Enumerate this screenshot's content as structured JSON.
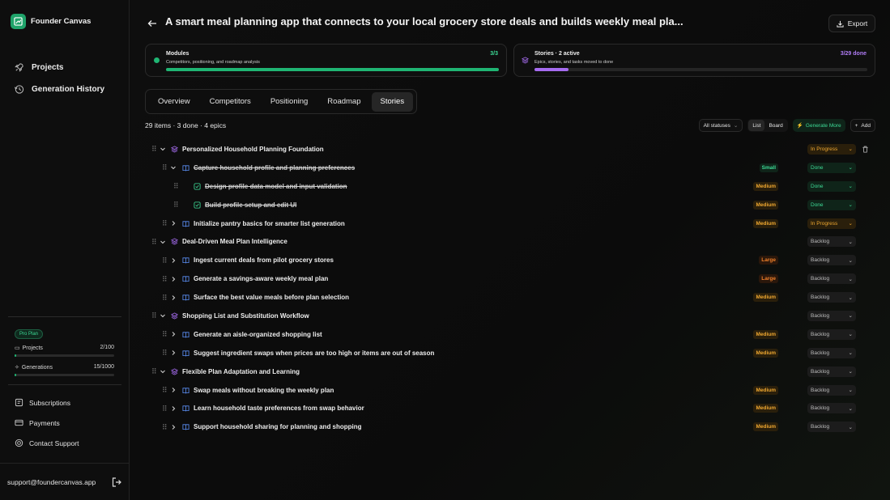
{
  "brand": {
    "name": "Founder Canvas",
    "accent": "#1fa36a"
  },
  "nav": [
    {
      "label": "Projects",
      "icon": "rocket-icon"
    },
    {
      "label": "Generation History",
      "icon": "history-icon"
    }
  ],
  "plan": {
    "badge": "Pro Plan",
    "projects": {
      "label": "Projects",
      "value": "2/100",
      "fraction": 0.02
    },
    "generations": {
      "label": "Generations",
      "value": "15/1000",
      "fraction": 0.015
    }
  },
  "side_links": [
    {
      "label": "Subscriptions",
      "icon": "subscriptions-icon"
    },
    {
      "label": "Payments",
      "icon": "credit-card-icon"
    },
    {
      "label": "Contact Support",
      "icon": "lifebuoy-icon"
    }
  ],
  "footer": {
    "email": "support@foundercanvas.app"
  },
  "header": {
    "title": "A smart meal planning app that connects to your local grocery store deals and builds weekly meal pla...",
    "export_label": "Export"
  },
  "modules_card": {
    "title": "Modules",
    "subtitle": "Competitors, positioning, and roadmap analysis",
    "value": "3/3",
    "progress": 1.0,
    "color": "#1fb573"
  },
  "stories_card": {
    "title": "Stories · 2 active",
    "subtitle": "Epics, stories, and tasks moved to done",
    "value": "3/29 done",
    "progress": 0.103,
    "color": "#a66cf0"
  },
  "tabs": [
    "Overview",
    "Competitors",
    "Positioning",
    "Roadmap",
    "Stories"
  ],
  "active_tab": "Stories",
  "summary": "29 items · 3 done · 4 epics",
  "filters": {
    "status_label": "All statuses",
    "view_list": "List",
    "view_board": "Board",
    "generate_label": "Generate More",
    "add_label": "Add"
  },
  "rows": [
    {
      "level": 0,
      "type": "epic",
      "text": "Personalized Household Planning Foundation",
      "size": "",
      "status": "In Progress",
      "expand": true,
      "done": false,
      "trash": true
    },
    {
      "level": 1,
      "type": "story",
      "text": "Capture household profile and planning preferences",
      "size": "Small",
      "status": "Done",
      "expand": true,
      "done": true
    },
    {
      "level": 2,
      "type": "task",
      "text": "Design profile data model and input validation",
      "size": "Medium",
      "status": "Done",
      "expand": false,
      "done": true
    },
    {
      "level": 2,
      "type": "task",
      "text": "Build profile setup and edit UI",
      "size": "Medium",
      "status": "Done",
      "expand": false,
      "done": true
    },
    {
      "level": 1,
      "type": "story",
      "text": "Initialize pantry basics for smarter list generation",
      "size": "Medium",
      "status": "In Progress",
      "expand": false,
      "done": false
    },
    {
      "level": 0,
      "type": "epic",
      "text": "Deal-Driven Meal Plan Intelligence",
      "size": "",
      "status": "Backlog",
      "expand": true,
      "done": false
    },
    {
      "level": 1,
      "type": "story",
      "text": "Ingest current deals from pilot grocery stores",
      "size": "Large",
      "status": "Backlog",
      "expand": false,
      "done": false
    },
    {
      "level": 1,
      "type": "story",
      "text": "Generate a savings-aware weekly meal plan",
      "size": "Large",
      "status": "Backlog",
      "expand": false,
      "done": false
    },
    {
      "level": 1,
      "type": "story",
      "text": "Surface the best value meals before plan selection",
      "size": "Medium",
      "status": "Backlog",
      "expand": false,
      "done": false
    },
    {
      "level": 0,
      "type": "epic",
      "text": "Shopping List and Substitution Workflow",
      "size": "",
      "status": "Backlog",
      "expand": true,
      "done": false
    },
    {
      "level": 1,
      "type": "story",
      "text": "Generate an aisle-organized shopping list",
      "size": "Medium",
      "status": "Backlog",
      "expand": false,
      "done": false
    },
    {
      "level": 1,
      "type": "story",
      "text": "Suggest ingredient swaps when prices are too high or items are out of season",
      "size": "Medium",
      "status": "Backlog",
      "expand": false,
      "done": false
    },
    {
      "level": 0,
      "type": "epic",
      "text": "Flexible Plan Adaptation and Learning",
      "size": "",
      "status": "Backlog",
      "expand": true,
      "done": false
    },
    {
      "level": 1,
      "type": "story",
      "text": "Swap meals without breaking the weekly plan",
      "size": "Medium",
      "status": "Backlog",
      "expand": false,
      "done": false
    },
    {
      "level": 1,
      "type": "story",
      "text": "Learn household taste preferences from swap behavior",
      "size": "Medium",
      "status": "Backlog",
      "expand": false,
      "done": false
    },
    {
      "level": 1,
      "type": "story",
      "text": "Support household sharing for planning and shopping",
      "size": "Medium",
      "status": "Backlog",
      "expand": false,
      "done": false
    }
  ]
}
